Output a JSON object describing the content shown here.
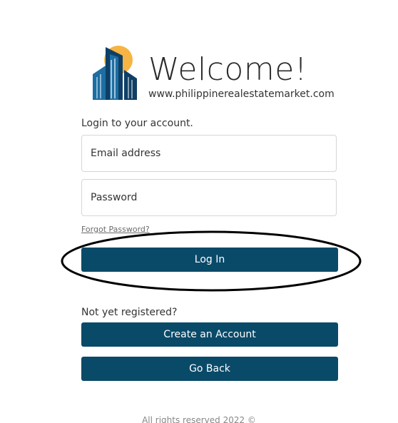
{
  "header": {
    "title": "Welcome!",
    "site_url": "www.philippinerealestatemarket.com"
  },
  "form": {
    "prompt": "Login to your account.",
    "email_placeholder": "Email address",
    "password_placeholder": "Password",
    "forgot_password": "Forgot Password?",
    "login_label": "Log In"
  },
  "register": {
    "prompt": "Not yet registered?",
    "create_label": "Create an Account",
    "back_label": "Go Back"
  },
  "footer": {
    "text": "All rights reserved 2022 ©"
  },
  "colors": {
    "button": "#0a4a69",
    "logo_sun": "#f5b443",
    "logo_building": "#1d5d8c"
  }
}
